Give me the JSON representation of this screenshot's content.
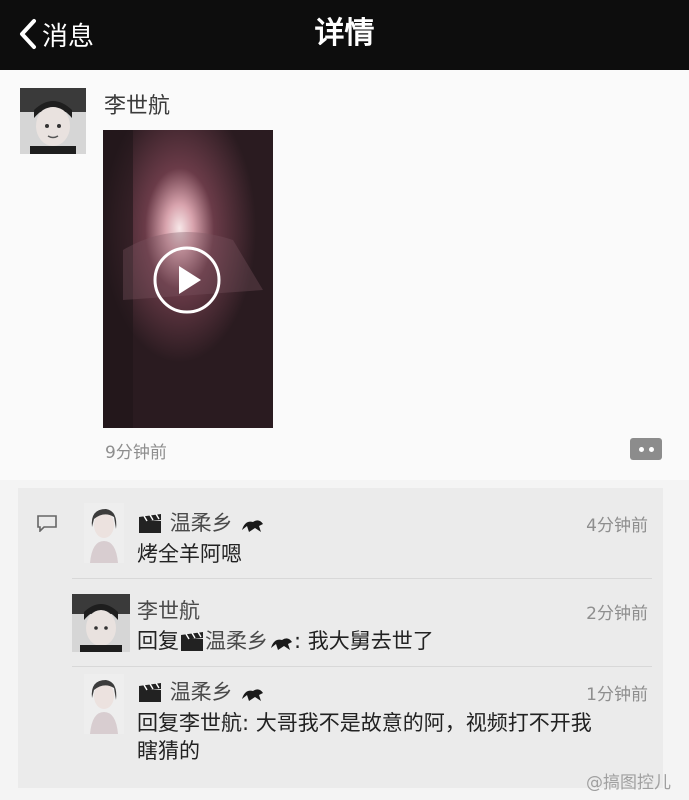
{
  "nav": {
    "back_label": "消息",
    "title": "详情"
  },
  "post": {
    "author": "李世航",
    "time": "9分钟前",
    "media": "video-thumbnail"
  },
  "comments": [
    {
      "name": "温柔乡",
      "text": "烤全羊阿嗯",
      "time": "4分钟前"
    },
    {
      "name": "李世航",
      "reply_prefix": "回复",
      "reply_to": "温柔乡",
      "text": ": 我大舅去世了",
      "time": "2分钟前"
    },
    {
      "name": "温柔乡",
      "reply_prefix": "回复",
      "reply_to": "李世航",
      "text_line1": "回复李世航: 大哥我不是故意的阿，视频打不开我",
      "text_line2": "瞎猜的",
      "time": "1分钟前"
    }
  ],
  "watermark": "@搞图控儿",
  "colors": {
    "navbar": "#0d0d0d",
    "background": "#f4f4f4",
    "comment_bg": "#ebebeb"
  }
}
